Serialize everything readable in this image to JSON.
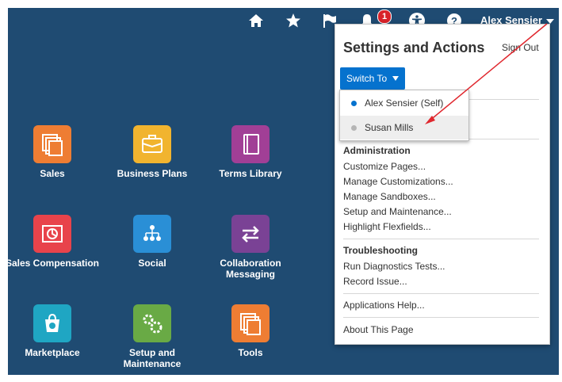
{
  "topbar": {
    "icons": [
      "home-icon",
      "favorites-star-icon",
      "watchlist-flag-icon",
      "notifications-bell-icon",
      "accessibility-icon",
      "help-icon"
    ],
    "notification_count": "1",
    "user_name": "Alex Sensier"
  },
  "tiles": [
    {
      "label": "Sales",
      "icon": "sales-icon",
      "color": "#ee7d33"
    },
    {
      "label": "Business Plans",
      "icon": "briefcase-icon",
      "color": "#f1b42f"
    },
    {
      "label": "Terms Library",
      "icon": "book-icon",
      "color": "#a13f96"
    },
    {
      "label": "Sales Compensation",
      "icon": "compensation-icon",
      "color": "#e8434b"
    },
    {
      "label": "Social",
      "icon": "social-network-icon",
      "color": "#2a8fd6"
    },
    {
      "label": "Collaboration Messaging",
      "icon": "messaging-arrows-icon",
      "color": "#7a4295"
    },
    {
      "label": "Marketplace",
      "icon": "marketplace-bag-icon",
      "color": "#1fa6c3"
    },
    {
      "label": "Setup and Maintenance",
      "icon": "gears-icon",
      "color": "#69aa45"
    },
    {
      "label": "Tools",
      "icon": "tools-icon",
      "color": "#ee7d33"
    }
  ],
  "panel": {
    "title": "Settings and Actions",
    "sign_out": "Sign Out",
    "switch_to": "Switch To",
    "switch_options": [
      {
        "label": "Alex Sensier (Self)",
        "dot_color": "#0572ce"
      },
      {
        "label": "Susan Mills",
        "dot_color": "#b5b5b5"
      }
    ],
    "administration": {
      "heading": "Administration",
      "links": [
        "Customize Pages...",
        "Manage Customizations...",
        "Manage Sandboxes...",
        "Setup and Maintenance...",
        "Highlight Flexfields..."
      ]
    },
    "troubleshooting": {
      "heading": "Troubleshooting",
      "links": [
        "Run Diagnostics Tests...",
        "Record Issue..."
      ]
    },
    "applications_help": "Applications Help...",
    "about_page": "About This Page"
  },
  "annotation": {
    "arrow_color": "#e0272e"
  }
}
